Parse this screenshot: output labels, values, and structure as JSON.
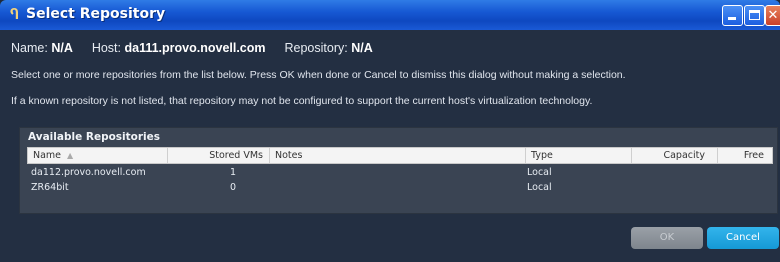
{
  "window": {
    "title": "Select Repository"
  },
  "info": {
    "name_label": "Name:",
    "name_value": "N/A",
    "host_label": "Host:",
    "host_value": "da111.provo.novell.com",
    "repo_label": "Repository:",
    "repo_value": "N/A"
  },
  "messages": [
    "Select one or more repositories from the list below.  Press OK when done or Cancel to dismiss this dialog without making a selection.",
    "If a known repository is not listed, that repository may not be configured to support the current host's virtualization technology."
  ],
  "panel": {
    "title": "Available Repositories",
    "columns": [
      "Name",
      "Stored VMs",
      "Notes",
      "Type",
      "Capacity",
      "Free"
    ],
    "rows": [
      {
        "name": "da112.provo.novell.com",
        "stored_vms": "1",
        "notes": "",
        "type": "Local",
        "capacity": "",
        "free": ""
      },
      {
        "name": "ZR64bit",
        "stored_vms": "0",
        "notes": "",
        "type": "Local",
        "capacity": "",
        "free": ""
      }
    ]
  },
  "buttons": {
    "ok": "OK",
    "cancel": "Cancel"
  },
  "icons": {
    "title_icon": "pin-icon",
    "sort": "sort-ascending-icon"
  }
}
